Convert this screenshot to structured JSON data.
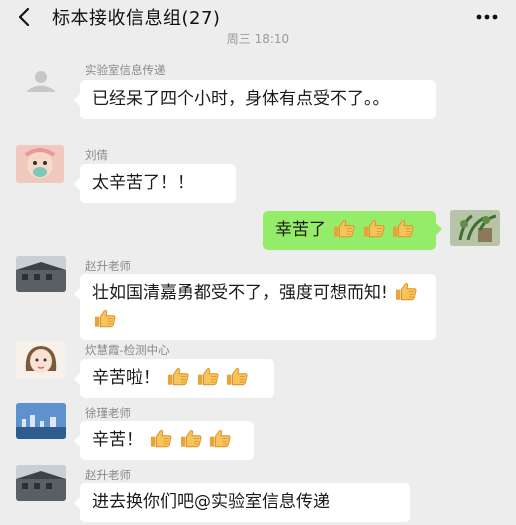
{
  "header": {
    "title": "标本接收信息组(27)",
    "back_icon": "chevron-left-icon",
    "more_icon": "more-dots-icon"
  },
  "timestamp": "周三 18:10",
  "emoji": {
    "thumbs_up_icon": "thumbs-up-icon"
  },
  "messages": [
    {
      "sender": "实验室信息传递",
      "text": "已经呆了四个小时，身体有点受不了。。",
      "emoji_count": 0
    },
    {
      "sender": "刘倩",
      "text": "太辛苦了！！",
      "emoji_count": 0
    },
    {
      "sender": "",
      "text": "幸苦了",
      "emoji_count": 3
    },
    {
      "sender": "赵升老师",
      "text": "壮如国清嘉勇都受不了，强度可想而知!",
      "emoji_count": 2
    },
    {
      "sender": "炊慧霞-检测中心",
      "text": "辛苦啦！",
      "emoji_count": 3
    },
    {
      "sender": "徐瑾老师",
      "text": "辛苦！",
      "emoji_count": 3
    },
    {
      "sender": "赵升老师",
      "text": "进去换你们吧@实验室信息传递",
      "emoji_count": 0
    }
  ],
  "colors": {
    "background": "#ededed",
    "bubble_in": "#ffffff",
    "bubble_out": "#95ec69"
  }
}
